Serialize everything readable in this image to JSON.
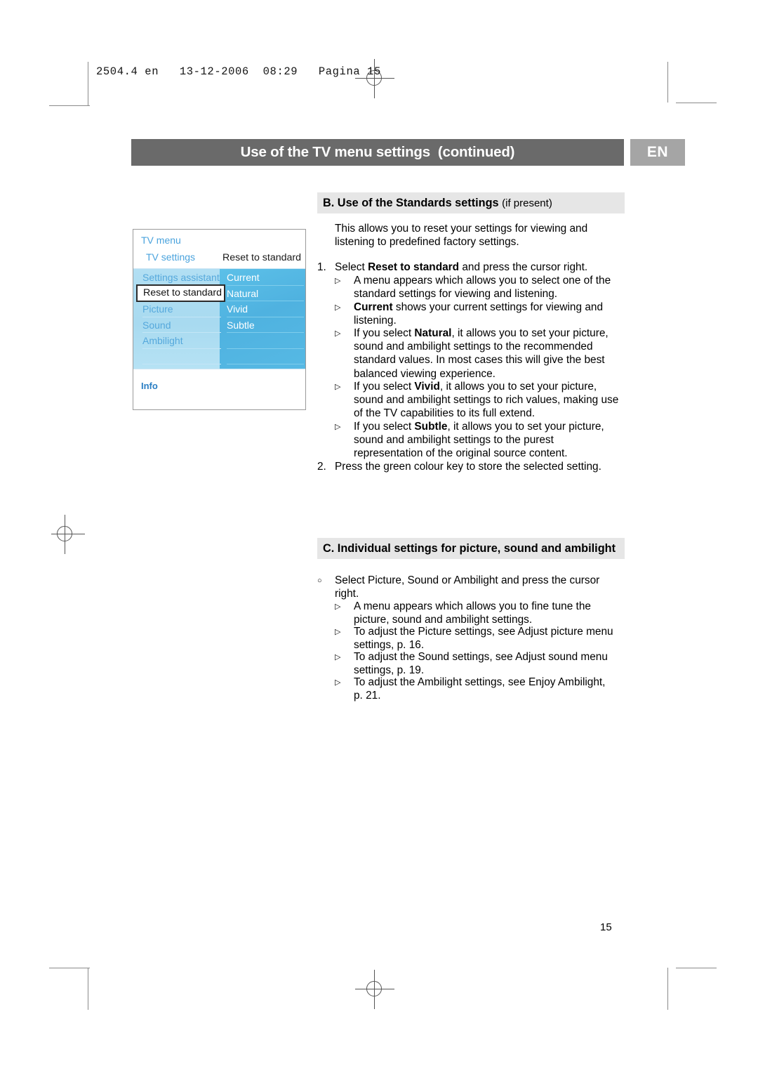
{
  "print_header": "2504.4 en   13-12-2006  08:29   Pagina 15",
  "header": {
    "title": "Use of the TV menu settings  (continued)",
    "language_badge": "EN"
  },
  "sections": {
    "b": {
      "heading_main": "B. Use of the Standards settings ",
      "heading_sub": "(if present)",
      "intro_line1": "This allows you to reset your settings for viewing and",
      "intro_line2": "listening to predefined factory settings.",
      "steps": [
        {
          "marker": "1.",
          "line1_pre": "Select ",
          "line1_bold": "Reset to standard",
          "line1_post": " and press the cursor right."
        },
        {
          "marker": "2.",
          "line1_pre": "Press the green colour key to store the selected setting.",
          "line1_bold": "",
          "line1_post": ""
        }
      ],
      "bullets": [
        {
          "marker": "▷",
          "lines": [
            {
              "pre": "A menu appears which allows you to select one of the",
              "bold": "",
              "post": ""
            },
            {
              "pre": "standard settings for viewing and listening.",
              "bold": "",
              "post": ""
            }
          ]
        },
        {
          "marker": "▷",
          "lines": [
            {
              "pre": "",
              "bold": "Current",
              "post": " shows your current settings for viewing and"
            },
            {
              "pre": "listening.",
              "bold": "",
              "post": ""
            }
          ]
        },
        {
          "marker": "▷",
          "lines": [
            {
              "pre": "If you select ",
              "bold": "Natural",
              "post": ", it allows you to set your picture,"
            },
            {
              "pre": "sound and ambilight settings to the recommended",
              "bold": "",
              "post": ""
            },
            {
              "pre": "standard values. In most cases this will give the best",
              "bold": "",
              "post": ""
            },
            {
              "pre": "balanced viewing experience.",
              "bold": "",
              "post": ""
            }
          ]
        },
        {
          "marker": "▷",
          "lines": [
            {
              "pre": "If you select ",
              "bold": "Vivid",
              "post": ", it allows you to set your picture,"
            },
            {
              "pre": "sound and ambilight settings to rich values, making use",
              "bold": "",
              "post": ""
            },
            {
              "pre": "of the TV capabilities to its full extend.",
              "bold": "",
              "post": ""
            }
          ]
        },
        {
          "marker": "▷",
          "lines": [
            {
              "pre": "If you select ",
              "bold": "Subtle",
              "post": ", it allows you to set your picture,"
            },
            {
              "pre": "sound and ambilight settings to the purest",
              "bold": "",
              "post": ""
            },
            {
              "pre": "representation of the original source content.",
              "bold": "",
              "post": ""
            }
          ]
        }
      ]
    },
    "c": {
      "heading_main": "C. Individual settings for picture, sound and ambilight",
      "heading_sub": "",
      "lead": {
        "marker": "○",
        "line1": "Select Picture, Sound or Ambilight and press the cursor",
        "line2": "right."
      },
      "bullets": [
        {
          "marker": "▷",
          "lines": [
            "A menu appears which allows you to fine tune the",
            "picture, sound and ambilight settings."
          ]
        },
        {
          "marker": "▷",
          "lines": [
            "To adjust the Picture settings, see Adjust picture menu",
            "settings, p. 16."
          ]
        },
        {
          "marker": "▷",
          "lines": [
            "To adjust the Sound settings, see Adjust sound menu",
            "settings, p. 19."
          ]
        },
        {
          "marker": "▷",
          "lines": [
            "To adjust the Ambilight settings, see Enjoy Ambilight,",
            "p. 21."
          ]
        }
      ]
    }
  },
  "tv_menu": {
    "title": "TV menu",
    "subtitle": "TV settings",
    "column_header": "Reset to standard",
    "left_items": [
      "Settings assistant",
      "Reset to standard",
      "Picture",
      "Sound",
      "Ambilight",
      "",
      ""
    ],
    "selected_left_item": "Reset to standard",
    "right_items": [
      "Current",
      "Natural",
      "Vivid",
      "Subtle",
      "",
      "",
      ""
    ],
    "info_label": "Info",
    "colors": {
      "left_panel": "#aedcf1",
      "right_panel": "#55b8e4",
      "accent_text": "#4aa3dd",
      "info_text": "#2a7fc4"
    }
  },
  "page_number": "15"
}
